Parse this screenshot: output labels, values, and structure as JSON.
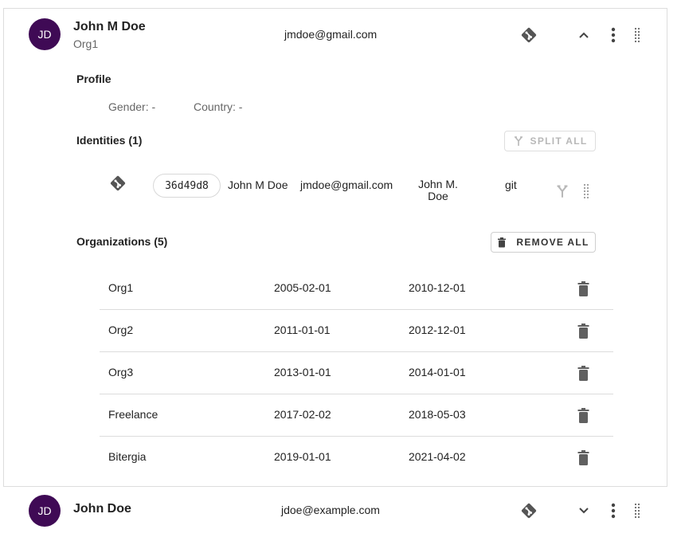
{
  "individuals": [
    {
      "initials": "JD",
      "name": "John M Doe",
      "organization": "Org1",
      "email": "jmdoe@gmail.com",
      "expanded": true,
      "profile": {
        "title": "Profile",
        "gender_label": "Gender: -",
        "country_label": "Country: -"
      },
      "identities": {
        "title": "Identities (1)",
        "split_all_label": "SPLIT ALL",
        "rows": [
          {
            "source_icon": "git-icon",
            "uuid": "36d49d8",
            "name": "John M Doe",
            "email": "jmdoe@gmail.com",
            "username_line1": "John M.",
            "username_line2": "Doe",
            "source": "git"
          }
        ]
      },
      "organizations": {
        "title": "Organizations (5)",
        "remove_all_label": "REMOVE ALL",
        "rows": [
          {
            "name": "Org1",
            "from": "2005-02-01",
            "to": "2010-12-01"
          },
          {
            "name": "Org2",
            "from": "2011-01-01",
            "to": "2012-12-01"
          },
          {
            "name": "Org3",
            "from": "2013-01-01",
            "to": "2014-01-01"
          },
          {
            "name": "Freelance",
            "from": "2017-02-02",
            "to": "2018-05-03"
          },
          {
            "name": "Bitergia",
            "from": "2019-01-01",
            "to": "2021-04-02"
          }
        ]
      }
    },
    {
      "initials": "JD",
      "name": "John Doe",
      "email": "jdoe@example.com",
      "expanded": false
    }
  ],
  "colors": {
    "avatar_bg": "#3f0a55",
    "icon_gray": "#555555",
    "disabled_gray": "#b8b8b8",
    "divider": "#dcdcdc"
  }
}
